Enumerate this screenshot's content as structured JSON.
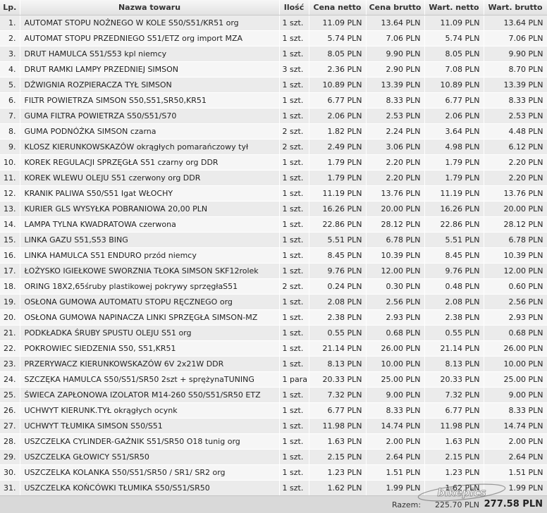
{
  "headers": [
    "Lp.",
    "Nazwa towaru",
    "Ilość",
    "Cena netto",
    "Cena brutto",
    "Wart. netto",
    "Wart. brutto"
  ],
  "rows": [
    [
      "1.",
      "AUTOMAT STOPU NOŻNEGO W KOLE S50/S51/KR51 org",
      "1 szt.",
      "11.09 PLN",
      "13.64 PLN",
      "11.09 PLN",
      "13.64 PLN"
    ],
    [
      "2.",
      "AUTOMAT STOPU PRZEDNIEGO S51/ETZ org import MZA",
      "1 szt.",
      "5.74 PLN",
      "7.06 PLN",
      "5.74 PLN",
      "7.06 PLN"
    ],
    [
      "3.",
      "DRUT HAMULCA S51/S53 kpl niemcy",
      "1 szt.",
      "8.05 PLN",
      "9.90 PLN",
      "8.05 PLN",
      "9.90 PLN"
    ],
    [
      "4.",
      "DRUT RAMKI LAMPY PRZEDNIEJ SIMSON",
      "3 szt.",
      "2.36 PLN",
      "2.90 PLN",
      "7.08 PLN",
      "8.70 PLN"
    ],
    [
      "5.",
      "DŹWIGNIA ROZPIERACZA TYŁ SIMSON",
      "1 szt.",
      "10.89 PLN",
      "13.39 PLN",
      "10.89 PLN",
      "13.39 PLN"
    ],
    [
      "6.",
      "FILTR POWIETRZA SIMSON S50,S51,SR50,KR51",
      "1 szt.",
      "6.77 PLN",
      "8.33 PLN",
      "6.77 PLN",
      "8.33 PLN"
    ],
    [
      "7.",
      "GUMA FILTRA POWIETRZA S50/S51/S70",
      "1 szt.",
      "2.06 PLN",
      "2.53 PLN",
      "2.06 PLN",
      "2.53 PLN"
    ],
    [
      "8.",
      "GUMA PODNÓŻKA SIMSON czarna",
      "2 szt.",
      "1.82 PLN",
      "2.24 PLN",
      "3.64 PLN",
      "4.48 PLN"
    ],
    [
      "9.",
      "KLOSZ KIERUNKOWSKAZÓW okrągłych pomarańczowy tył",
      "2 szt.",
      "2.49 PLN",
      "3.06 PLN",
      "4.98 PLN",
      "6.12 PLN"
    ],
    [
      "10.",
      "KOREK REGULACJI SPRZĘGŁA S51 czarny org DDR",
      "1 szt.",
      "1.79 PLN",
      "2.20 PLN",
      "1.79 PLN",
      "2.20 PLN"
    ],
    [
      "11.",
      "KOREK WLEWU OLEJU S51 czerwony org DDR",
      "1 szt.",
      "1.79 PLN",
      "2.20 PLN",
      "1.79 PLN",
      "2.20 PLN"
    ],
    [
      "12.",
      "KRANIK PALIWA S50/S51 Igat WŁOCHY",
      "1 szt.",
      "11.19 PLN",
      "13.76 PLN",
      "11.19 PLN",
      "13.76 PLN"
    ],
    [
      "13.",
      "KURIER GLS WYSYŁKA POBRANIOWA 20,00 PLN",
      "1 szt.",
      "16.26 PLN",
      "20.00 PLN",
      "16.26 PLN",
      "20.00 PLN"
    ],
    [
      "14.",
      "LAMPA TYLNA KWADRATOWA czerwona",
      "1 szt.",
      "22.86 PLN",
      "28.12 PLN",
      "22.86 PLN",
      "28.12 PLN"
    ],
    [
      "15.",
      "LINKA GAZU S51,S53 BING",
      "1 szt.",
      "5.51 PLN",
      "6.78 PLN",
      "5.51 PLN",
      "6.78 PLN"
    ],
    [
      "16.",
      "LINKA HAMULCA S51 ENDURO przód niemcy",
      "1 szt.",
      "8.45 PLN",
      "10.39 PLN",
      "8.45 PLN",
      "10.39 PLN"
    ],
    [
      "17.",
      "ŁOŻYSKO IGIEŁKOWE SWORZNIA TŁOKA SIMSON SKF12rolek",
      "1 szt.",
      "9.76 PLN",
      "12.00 PLN",
      "9.76 PLN",
      "12.00 PLN"
    ],
    [
      "18.",
      "ORING 18X2,65śruby plastikowej pokrywy sprzęgłaS51",
      "2 szt.",
      "0.24 PLN",
      "0.30 PLN",
      "0.48 PLN",
      "0.60 PLN"
    ],
    [
      "19.",
      "OSŁONA GUMOWA AUTOMATU STOPU RĘCZNEGO org",
      "1 szt.",
      "2.08 PLN",
      "2.56 PLN",
      "2.08 PLN",
      "2.56 PLN"
    ],
    [
      "20.",
      "OSŁONA GUMOWA NAPINACZA LINKI SPRZĘGŁA SIMSON-MZ",
      "1 szt.",
      "2.38 PLN",
      "2.93 PLN",
      "2.38 PLN",
      "2.93 PLN"
    ],
    [
      "21.",
      "PODKŁADKA ŚRUBY SPUSTU OLEJU S51 org",
      "1 szt.",
      "0.55 PLN",
      "0.68 PLN",
      "0.55 PLN",
      "0.68 PLN"
    ],
    [
      "22.",
      "POKROWIEC SIEDZENIA S50, S51,KR51",
      "1 szt.",
      "21.14 PLN",
      "26.00 PLN",
      "21.14 PLN",
      "26.00 PLN"
    ],
    [
      "23.",
      "PRZERYWACZ KIERUNKOWSKAZÓW 6V 2x21W DDR",
      "1 szt.",
      "8.13 PLN",
      "10.00 PLN",
      "8.13 PLN",
      "10.00 PLN"
    ],
    [
      "24.",
      "SZCZĘKA HAMULCA S50/S51/SR50 2szt + sprężynaTUNING",
      "1 para",
      "20.33 PLN",
      "25.00 PLN",
      "20.33 PLN",
      "25.00 PLN"
    ],
    [
      "25.",
      "ŚWIECA ZAPŁONOWA IZOLATOR M14-260 S50/S51/SR50 ETZ",
      "1 szt.",
      "7.32 PLN",
      "9.00 PLN",
      "7.32 PLN",
      "9.00 PLN"
    ],
    [
      "26.",
      "UCHWYT KIERUNK.TYŁ okrągłych ocynk",
      "1 szt.",
      "6.77 PLN",
      "8.33 PLN",
      "6.77 PLN",
      "8.33 PLN"
    ],
    [
      "27.",
      "UCHWYT TŁUMIKA SIMSON S50/S51",
      "1 szt.",
      "11.98 PLN",
      "14.74 PLN",
      "11.98 PLN",
      "14.74 PLN"
    ],
    [
      "28.",
      "USZCZELKA CYLINDER-GAŹNIK S51/SR50 O18 tunig org",
      "1 szt.",
      "1.63 PLN",
      "2.00 PLN",
      "1.63 PLN",
      "2.00 PLN"
    ],
    [
      "29.",
      "USZCZELKA GŁOWICY S51/SR50",
      "1 szt.",
      "2.15 PLN",
      "2.64 PLN",
      "2.15 PLN",
      "2.64 PLN"
    ],
    [
      "30.",
      "USZCZELKA KOLANKA S50/S51/SR50 / SR1/ SR2 org",
      "1 szt.",
      "1.23 PLN",
      "1.51 PLN",
      "1.23 PLN",
      "1.51 PLN"
    ],
    [
      "31.",
      "USZCZELKA KOŃCÓWKI TŁUMIKA S50/S51/SR50",
      "1 szt.",
      "1.62 PLN",
      "1.99 PLN",
      "1.62 PLN",
      "1.99 PLN"
    ]
  ],
  "summary": {
    "label": "Razem:",
    "netto_total": "225.70 PLN",
    "brutto_total": "277.58 PLN"
  },
  "watermark": {
    "text": "bikepics"
  }
}
